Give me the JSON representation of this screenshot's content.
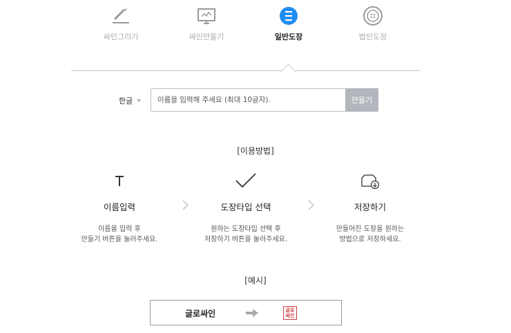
{
  "tabs": [
    {
      "label": "싸인그리기",
      "icon": "pen-draw-icon"
    },
    {
      "label": "싸인만들기",
      "icon": "monitor-signature-icon"
    },
    {
      "label": "일반도장",
      "icon": "round-seal-icon"
    },
    {
      "label": "법인도장",
      "icon": "corporate-seal-icon"
    }
  ],
  "form": {
    "language": "한글",
    "input_placeholder": "이름을 입력해 주세요 (최대 10글자).",
    "make_label": "만들기"
  },
  "howto": {
    "title": "[이용방법]",
    "steps": [
      {
        "title": "이름입력",
        "line1": "이름을 입력 후",
        "line2": "만들기 버튼을 눌러주세요."
      },
      {
        "title": "도장타입 선택",
        "line1": "원하는 도장타입 선택 후",
        "line2": "저장하기 버튼을 눌러주세요."
      },
      {
        "title": "저장하기",
        "line1": "만들어진 도장을 원하는",
        "line2": "방법으로 저장하세요."
      }
    ]
  },
  "example": {
    "title": "[예시]",
    "name": "글로싸인",
    "stamp_top": "글로",
    "stamp_bottom": "싸인"
  },
  "colors": {
    "accent": "#1e8cf0",
    "stamp": "#d23c3c",
    "button": "#b3b6bc"
  }
}
